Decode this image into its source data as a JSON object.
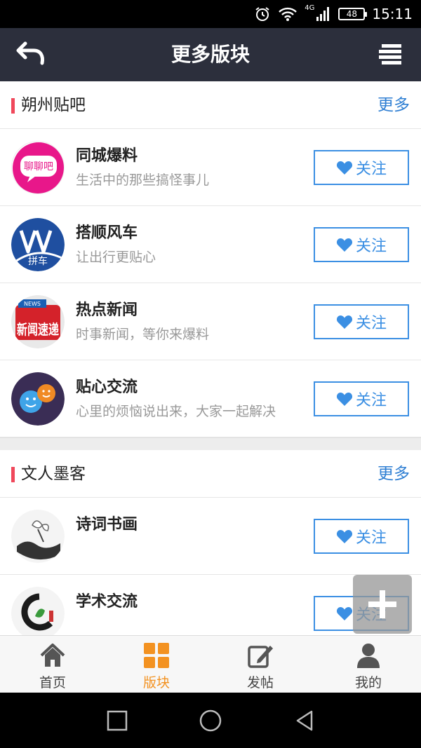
{
  "status_bar": {
    "time": "15:11",
    "battery": "48",
    "network": "4G",
    "icons": [
      "alarm-icon",
      "wifi-icon",
      "signal-icon",
      "battery-icon"
    ]
  },
  "header": {
    "title": "更多版块",
    "back_icon": "back-arrow-icon",
    "menu_icon": "menu-icon"
  },
  "sections": [
    {
      "title": "朔州贴吧",
      "more": "更多",
      "items": [
        {
          "name": "同城爆料",
          "desc": "生活中的那些搞怪事儿",
          "follow": "关注",
          "avatar_text": "聊聊吧"
        },
        {
          "name": "搭顺风车",
          "desc": "让出行更贴心",
          "follow": "关注",
          "avatar_text": "拼车"
        },
        {
          "name": "热点新闻",
          "desc": "时事新闻，等你来爆料",
          "follow": "关注",
          "avatar_text": "新闻速递"
        },
        {
          "name": "贴心交流",
          "desc": "心里的烦恼说出来，大家一起解决",
          "follow": "关注"
        }
      ]
    },
    {
      "title": "文人墨客",
      "more": "更多",
      "items": [
        {
          "name": "诗词书画",
          "desc": "",
          "follow": "关注"
        },
        {
          "name": "学术交流",
          "desc": "",
          "follow": "关注"
        }
      ]
    }
  ],
  "bottom_nav": [
    {
      "label": "首页",
      "icon": "home-icon",
      "active": false
    },
    {
      "label": "版块",
      "icon": "grid-icon",
      "active": true
    },
    {
      "label": "发帖",
      "icon": "edit-icon",
      "active": false
    },
    {
      "label": "我的",
      "icon": "user-icon",
      "active": false
    }
  ],
  "colors": {
    "header_bg": "#2c2f3c",
    "accent_blue": "#3b8fe3",
    "accent_orange": "#f39221",
    "section_bar": "#f0485b"
  }
}
